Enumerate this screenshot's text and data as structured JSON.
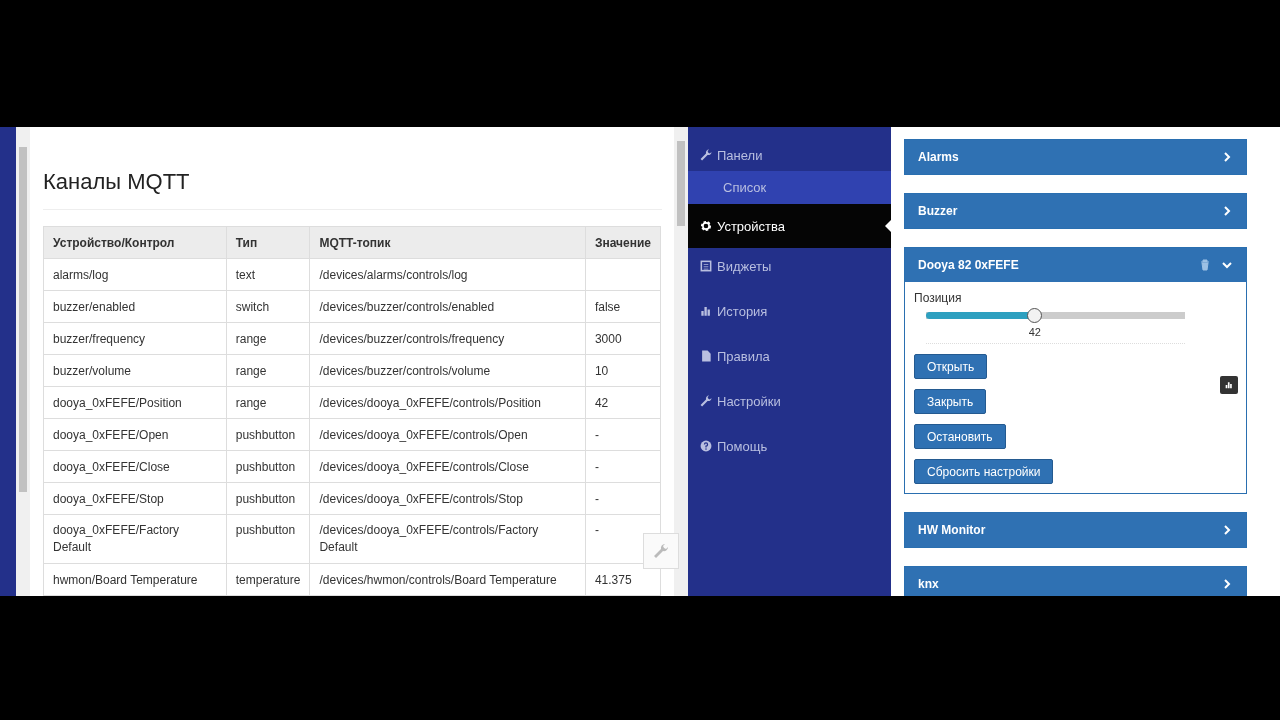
{
  "mqtt_window": {
    "title": "Каналы MQTT",
    "table": {
      "columns": [
        "Устройство/Контрол",
        "Тип",
        "MQTT-топик",
        "Значение"
      ],
      "rows": [
        [
          "alarms/log",
          "text",
          "/devices/alarms/controls/log",
          ""
        ],
        [
          "buzzer/enabled",
          "switch",
          "/devices/buzzer/controls/enabled",
          "false"
        ],
        [
          "buzzer/frequency",
          "range",
          "/devices/buzzer/controls/frequency",
          "3000"
        ],
        [
          "buzzer/volume",
          "range",
          "/devices/buzzer/controls/volume",
          "10"
        ],
        [
          "dooya_0xFEFE/Position",
          "range",
          "/devices/dooya_0xFEFE/controls/Position",
          "42"
        ],
        [
          "dooya_0xFEFE/Open",
          "pushbutton",
          "/devices/dooya_0xFEFE/controls/Open",
          "-"
        ],
        [
          "dooya_0xFEFE/Close",
          "pushbutton",
          "/devices/dooya_0xFEFE/controls/Close",
          "-"
        ],
        [
          "dooya_0xFEFE/Stop",
          "pushbutton",
          "/devices/dooya_0xFEFE/controls/Stop",
          "-"
        ],
        [
          "dooya_0xFEFE/Factory Default",
          "pushbutton",
          "/devices/dooya_0xFEFE/controls/Factory Default",
          "-"
        ],
        [
          "hwmon/Board Temperature",
          "temperature",
          "/devices/hwmon/controls/Board Temperature",
          "41.375"
        ]
      ]
    }
  },
  "sidebar": {
    "items": [
      {
        "label": "Панели",
        "selected": false,
        "children": [
          {
            "label": "Список",
            "selected": false
          }
        ]
      },
      {
        "label": "Устройства",
        "selected": true
      },
      {
        "label": "Виджеты",
        "selected": false
      },
      {
        "label": "История",
        "selected": false
      },
      {
        "label": "Правила",
        "selected": false
      },
      {
        "label": "Настройки",
        "selected": false
      },
      {
        "label": "Помощь",
        "selected": false
      }
    ]
  },
  "devices": [
    {
      "title": "Alarms",
      "expanded": false
    },
    {
      "title": "Buzzer",
      "expanded": false
    },
    {
      "title": "Dooya 82 0xFEFE",
      "expanded": true,
      "controls": [
        {
          "kind": "slider",
          "label": "Позиция",
          "level": 0.42,
          "reading": "42"
        },
        {
          "kind": "button",
          "label": "Открыть"
        },
        {
          "kind": "button",
          "label": "Закрыть"
        },
        {
          "kind": "button",
          "label": "Остановить"
        },
        {
          "kind": "button",
          "label": "Сбросить настройки"
        }
      ]
    },
    {
      "title": "HW Monitor",
      "expanded": false
    },
    {
      "title": "knx",
      "expanded": false
    }
  ]
}
